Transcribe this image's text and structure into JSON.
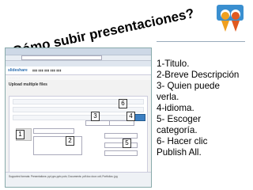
{
  "title": "¿Cómo subir presentaciones?",
  "steps": [
    "1-Titulo.",
    "2-Breve Descripción",
    "3- Quien puede",
    "verla.",
    "4-idioma.",
    "5- Escoger",
    "categoría.",
    "6- Hacer clic",
    "Publish All."
  ],
  "screenshot": {
    "site_logo": "slideshare",
    "page_heading": "Upload multiple files",
    "footer_text": "Supported formats: Presentations: ppt pps pptx potx; Documents: pdf doc docx odt; Portfolios: jpg"
  },
  "badges": [
    "1",
    "2",
    "3",
    "4",
    "5",
    "6"
  ],
  "colors": {
    "brand_blue": "#2a6db0",
    "logo_orange": "#f0a020",
    "logo_blue": "#3a8fd0"
  }
}
